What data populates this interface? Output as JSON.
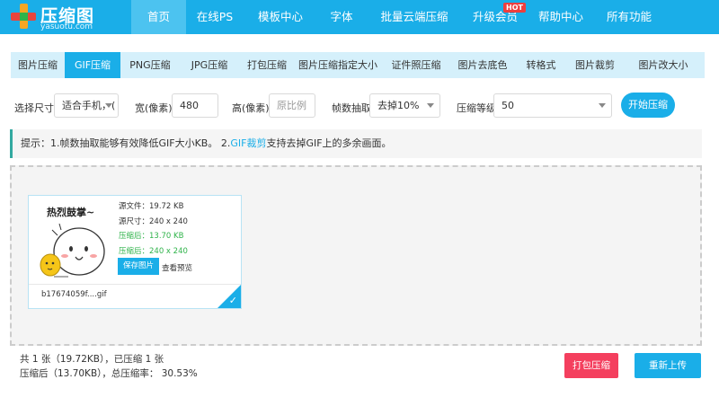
{
  "logo": {
    "title": "压缩图",
    "subtitle": "yasuotu.com"
  },
  "nav": [
    {
      "label": "首页",
      "active": true
    },
    {
      "label": "在线PS"
    },
    {
      "label": "模板中心"
    },
    {
      "label": "字体"
    },
    {
      "label": "批量云端压缩"
    },
    {
      "label": "升级会员",
      "badge": "HOT"
    },
    {
      "label": "帮助中心"
    },
    {
      "label": "所有功能"
    }
  ],
  "tabs": [
    {
      "label": "图片压缩"
    },
    {
      "label": "GIF压缩",
      "active": true
    },
    {
      "label": "PNG压缩"
    },
    {
      "label": "JPG压缩"
    },
    {
      "label": "打包压缩"
    },
    {
      "label": "图片压缩指定大小"
    },
    {
      "label": "证件照压缩"
    },
    {
      "label": "图片去底色"
    },
    {
      "label": "转格式"
    },
    {
      "label": "图片裁剪"
    },
    {
      "label": "图片改大小"
    }
  ],
  "options": {
    "size_label": "选择尺寸",
    "size_value": "适合手机，(",
    "width_label": "宽(像素)",
    "width_value": "480",
    "height_label": "高(像素)",
    "height_placeholder": "原比例",
    "frame_label": "帧数抽取",
    "frame_value": "去掉10%",
    "level_label": "压缩等级",
    "level_value": "50",
    "start_button": "开始压缩"
  },
  "tip": {
    "prefix": "提示：1.帧数抽取能够有效降低GIF大小KB。 2.",
    "link": "GIF裁剪",
    "suffix": "支持去掉GIF上的多余画面。"
  },
  "file": {
    "thumb_caption": "热烈鼓掌~",
    "source_size": "源文件：19.72 KB",
    "source_dims": "源尺寸：240 x 240",
    "compressed_size": "压缩后：13.70 KB",
    "compressed_dims": "压缩后：240 x 240",
    "save_button": "保存图片",
    "preview_link": "查看预览",
    "filename": "b17674059f....gif",
    "check": "✓"
  },
  "footer": {
    "stat_line1": "共 1 张（19.72KB），已压缩 1 张",
    "stat_line2": "压缩后（13.70KB），总压缩率： 30.53%",
    "pack_button": "打包压缩",
    "reupload_button": "重新上传"
  },
  "colors": {
    "primary": "#1aaee8",
    "tab_bg": "#d5f0fb",
    "danger": "#f43f5e",
    "success": "#2fb34a"
  }
}
